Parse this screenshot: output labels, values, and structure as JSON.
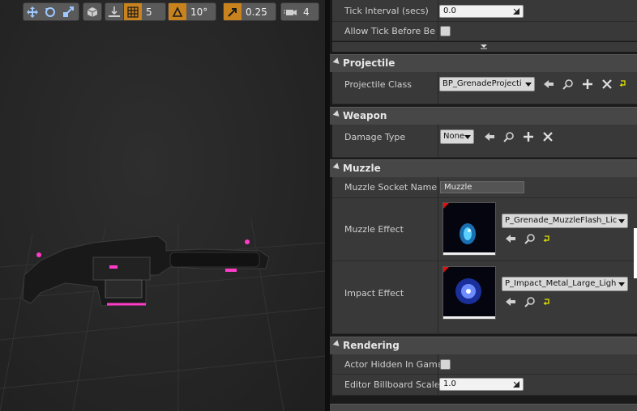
{
  "toolbar": {
    "grid_snap_value": "5",
    "rotation_snap_value": "10°",
    "scale_snap_value": "0.25",
    "camera_speed_value": "4"
  },
  "details": {
    "actor_tick": {
      "tick_interval_label": "Tick Interval (secs)",
      "tick_interval_value": "0.0",
      "allow_tick_label": "Allow Tick Before Begi"
    },
    "projectile": {
      "title": "Projectile",
      "class_label": "Projectile Class",
      "class_value": "BP_GrenadeProjecti"
    },
    "weapon": {
      "title": "Weapon",
      "damage_type_label": "Damage Type",
      "damage_type_value": "None"
    },
    "muzzle": {
      "title": "Muzzle",
      "socket_label": "Muzzle Socket Name",
      "socket_value": "Muzzle",
      "effect_label": "Muzzle Effect",
      "effect_value": "P_Grenade_MuzzleFlash_Lic",
      "impact_label": "Impact Effect",
      "impact_value": "P_Impact_Metal_Large_Ligh"
    },
    "rendering": {
      "title": "Rendering",
      "hidden_label": "Actor Hidden In Game",
      "billboard_label": "Editor Billboard Scale",
      "billboard_value": "1.0"
    }
  },
  "colors": {
    "panel_bg": "#393939",
    "category_bg": "#474747",
    "toolbar_active": "#c8821e",
    "accent_reset": "#e8e800",
    "weapon_glow": "#ff3cc8"
  }
}
